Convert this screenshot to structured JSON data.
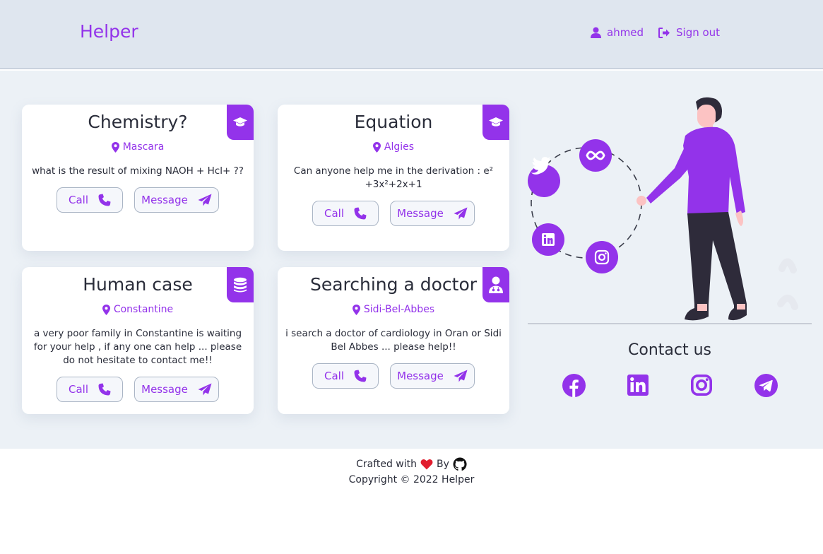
{
  "header": {
    "brand": "Helper",
    "user_name": "ahmed",
    "signout_label": "Sign out"
  },
  "posts": [
    {
      "title": "Chemistry?",
      "location": "Mascara",
      "description": "what is the result of mixing NAOH + Hcl+ ??",
      "category_icon": "graduation-cap-icon"
    },
    {
      "title": "Equation",
      "location": "Algies",
      "description": "Can anyone help me in the derivation : e² +3x²+2x+1",
      "category_icon": "graduation-cap-icon"
    },
    {
      "title": "Human case",
      "location": "Constantine",
      "description": "a very poor family in Constantine is waiting for your help , if any one can help ... please do not hesitate to contact me!!",
      "category_icon": "coins-icon"
    },
    {
      "title": "Searching a doctor",
      "location": "Sidi-Bel-Abbes",
      "description": "i search a doctor of cardiology in Oran or Sidi Bel Abbes ... please help!!",
      "category_icon": "user-doctor-icon"
    }
  ],
  "actions": {
    "call_label": "Call",
    "message_label": "Message"
  },
  "contact": {
    "title": "Contact us",
    "socials": [
      "facebook-icon",
      "linkedin-icon",
      "instagram-icon",
      "telegram-icon"
    ]
  },
  "footer": {
    "crafted_prefix": "Crafted with",
    "by_label": "By",
    "copyright": "Copyright © 2022 Helper"
  },
  "colors": {
    "accent": "#9333ea",
    "header_bg": "#dfe6ef",
    "main_bg": "#ecf1f6",
    "heart": "#e11d2e"
  }
}
